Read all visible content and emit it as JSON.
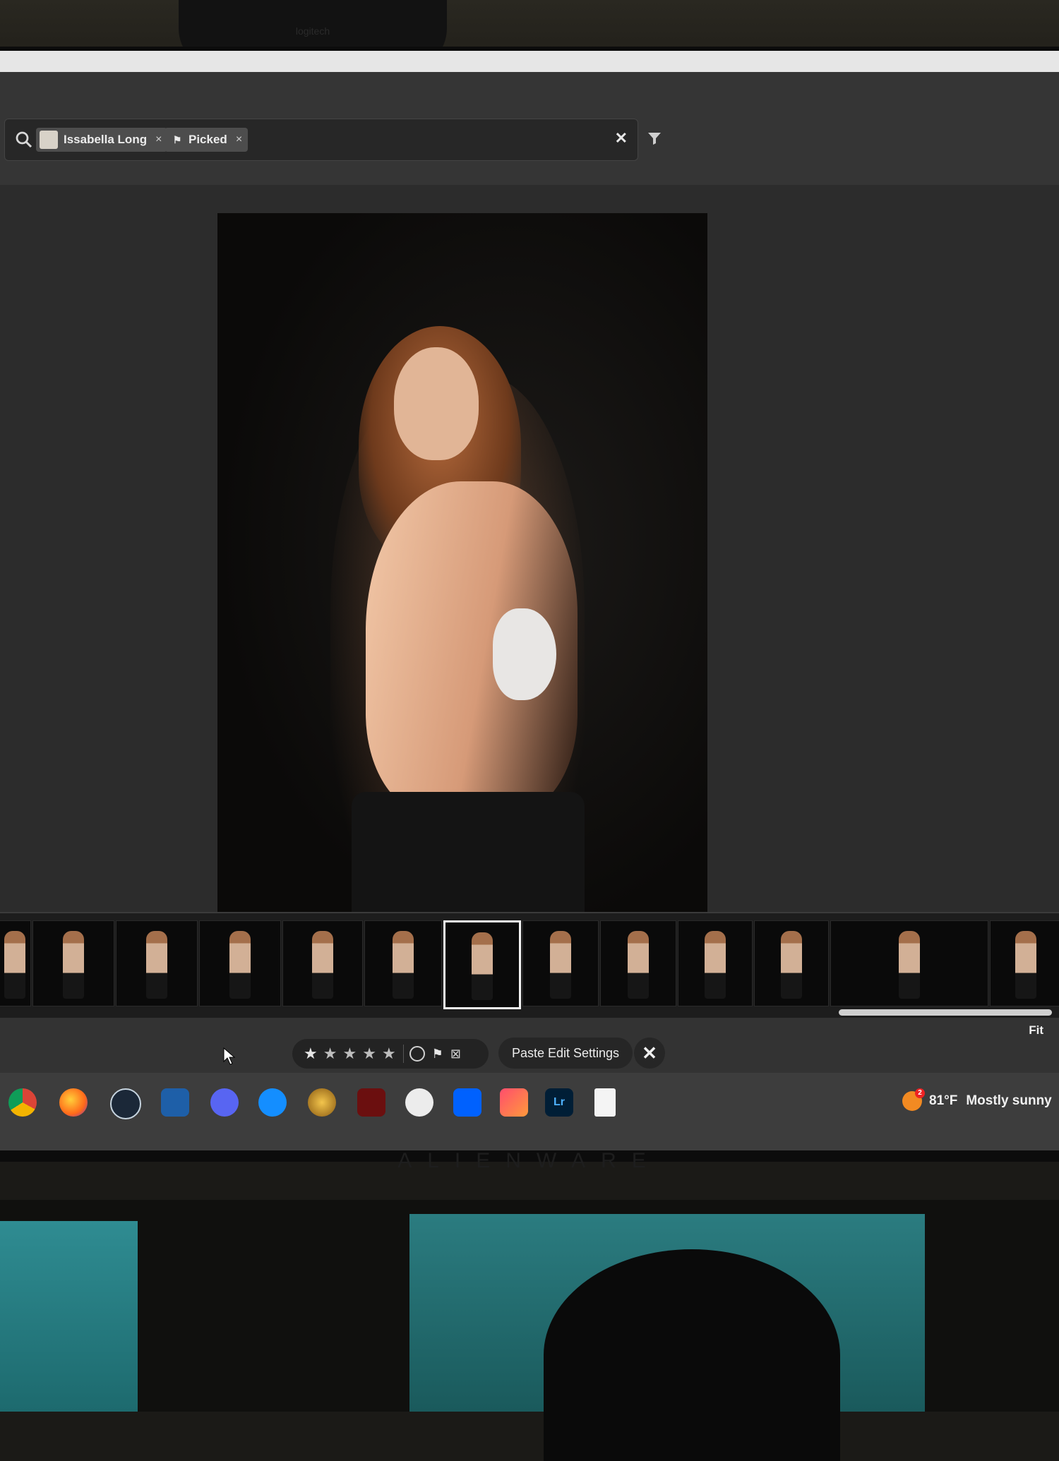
{
  "webcam": {
    "brand": "logitech"
  },
  "search": {
    "chips": [
      {
        "label": "Issabella Long",
        "close": "×"
      },
      {
        "label": "Picked",
        "close": "×"
      }
    ],
    "clear": "✕"
  },
  "filmstrip": {
    "thumbnail_count": 13,
    "selected_index": 6
  },
  "toolbar": {
    "fit_label": "Fit",
    "rating": {
      "stars": [
        "★",
        "★",
        "★",
        "★",
        "★"
      ],
      "selected": 0
    },
    "flag_glyph": "⚑",
    "reject_glyph": "⊠",
    "paste_label": "Paste Edit Settings",
    "close_glyph": "✕"
  },
  "taskbar": {
    "apps": [
      "chrome-icon",
      "firefox-icon",
      "steam-icon",
      "davinci-resolve-icon",
      "discord-icon",
      "battlenet-icon",
      "world-of-warcraft-icon",
      "diablo-icon",
      "app-icon",
      "dropbox-icon",
      "creative-cloud-icon",
      "lightroom-icon",
      "document-icon"
    ],
    "lightroom_label": "Lr",
    "weather": {
      "notification_count": "2",
      "temp": "81°F",
      "condition": "Mostly sunny"
    }
  },
  "monitor": {
    "brand": "ALIENWARE"
  },
  "colors": {
    "lightroom_blue": "#4fb3ff",
    "weather_orange": "#f28a22",
    "screen_bg": "#2b2b2b"
  }
}
